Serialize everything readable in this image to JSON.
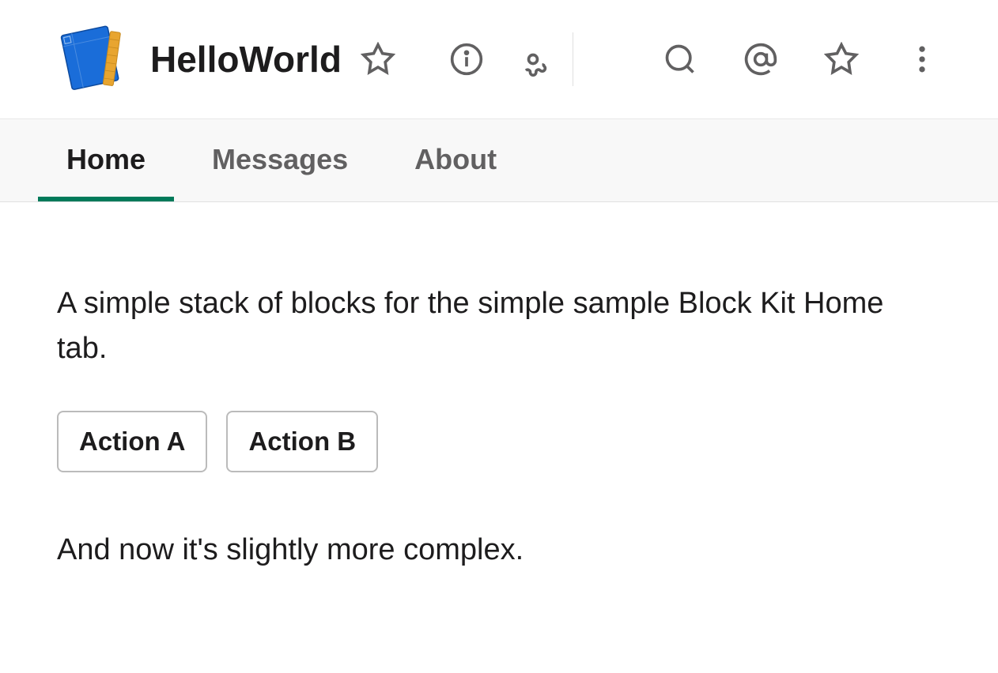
{
  "header": {
    "title": "HelloWorld"
  },
  "tabs": [
    {
      "label": "Home",
      "active": true
    },
    {
      "label": "Messages",
      "active": false
    },
    {
      "label": "About",
      "active": false
    }
  ],
  "content": {
    "text1": "A simple stack of blocks for the simple sample Block Kit Home tab.",
    "actions": [
      {
        "label": "Action A"
      },
      {
        "label": "Action B"
      }
    ],
    "text2": "And now it's slightly more complex."
  }
}
